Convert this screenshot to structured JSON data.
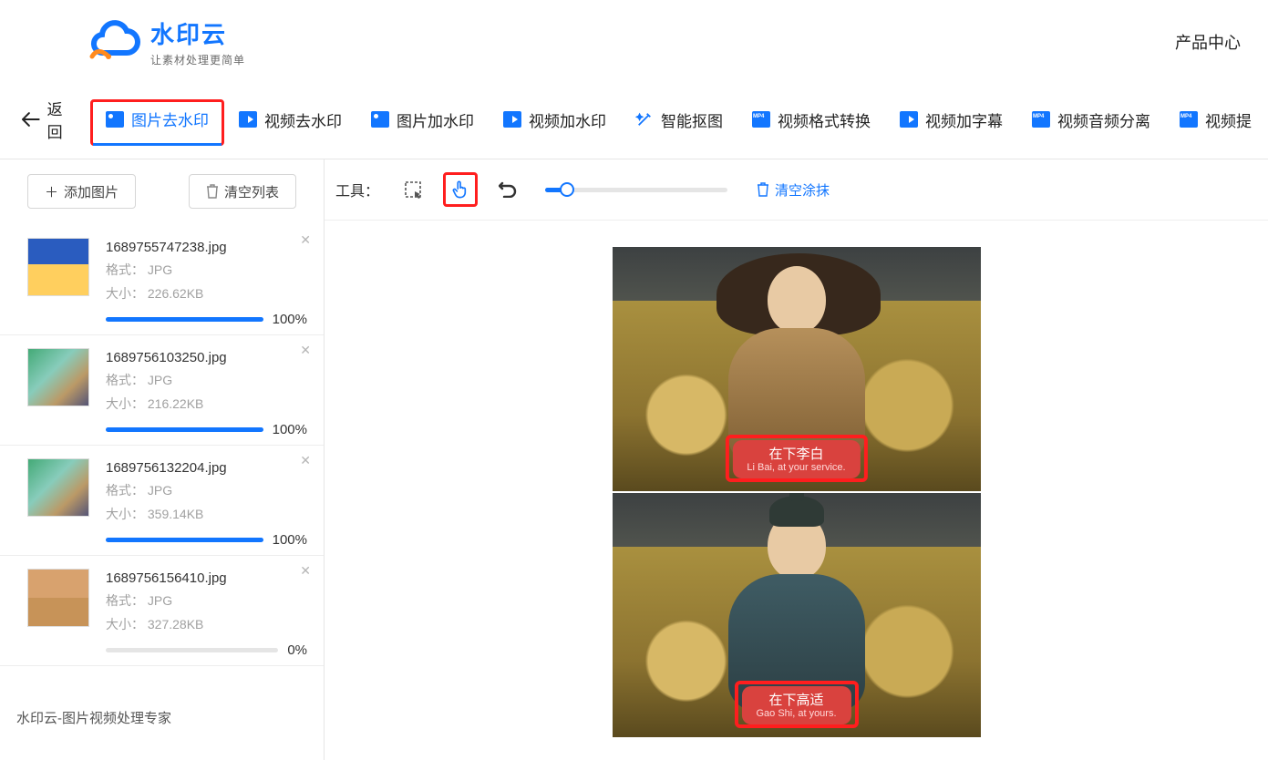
{
  "header": {
    "logo_title": "水印云",
    "logo_sub": "让素材处理更简单",
    "product_center": "产品中心"
  },
  "tabs": {
    "back": "返回",
    "items": [
      "图片去水印",
      "视频去水印",
      "图片加水印",
      "视频加水印",
      "智能抠图",
      "视频格式转换",
      "视频加字幕",
      "视频音频分离",
      "视频提"
    ]
  },
  "sidebar": {
    "add_btn": "添加图片",
    "clear_btn": "清空列表",
    "format_label": "格式：",
    "size_label": "大小：",
    "files": [
      {
        "name": "1689755747238.jpg",
        "format": "JPG",
        "size": "226.62KB",
        "pct": "100%",
        "pctv": 100
      },
      {
        "name": "1689756103250.jpg",
        "format": "JPG",
        "size": "216.22KB",
        "pct": "100%",
        "pctv": 100
      },
      {
        "name": "1689756132204.jpg",
        "format": "JPG",
        "size": "359.14KB",
        "pct": "100%",
        "pctv": 100
      },
      {
        "name": "1689756156410.jpg",
        "format": "JPG",
        "size": "327.28KB",
        "pct": "0%",
        "pctv": 0
      }
    ]
  },
  "toolbar": {
    "label": "工具：",
    "clear_strokes": "清空涂抹"
  },
  "preview": {
    "cap1_zh": "在下李白",
    "cap1_en": "Li Bai, at your service.",
    "cap2_zh": "在下高适",
    "cap2_en": "Gao Shi, at yours."
  },
  "footer": "水印云-图片视频处理专家"
}
